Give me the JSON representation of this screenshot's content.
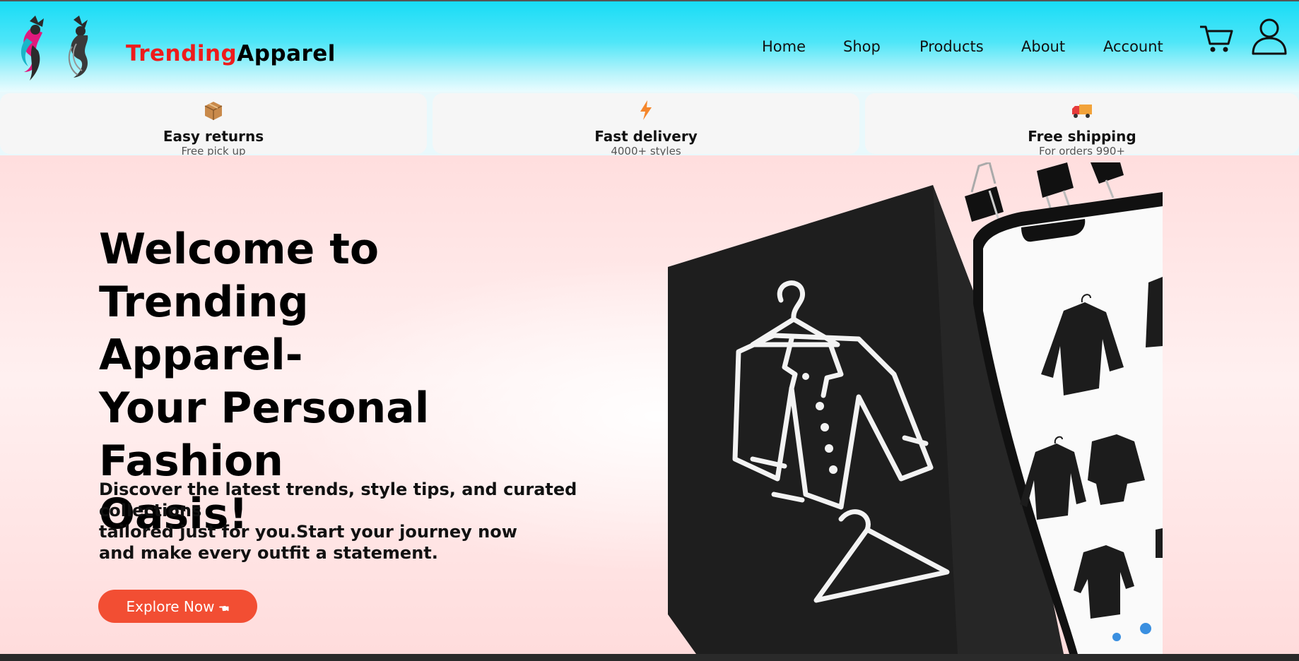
{
  "brand": {
    "part1": "Trending",
    "part2": "Apparel"
  },
  "nav": {
    "items": [
      "Home",
      "Shop",
      "Products",
      "About",
      "Account"
    ]
  },
  "icons": {
    "logo": "fashion-logo-icon",
    "cart": "cart-icon",
    "user": "user-icon"
  },
  "features": [
    {
      "icon": "package-icon",
      "title": "Easy returns",
      "subtitle": "Free pick up"
    },
    {
      "icon": "lightning-icon",
      "title": "Fast delivery",
      "subtitle": "4000+ styles"
    },
    {
      "icon": "delivery-truck-icon",
      "title": "Free shipping",
      "subtitle": "For orders 990+"
    }
  ],
  "hero": {
    "title_lines": [
      "Welcome to Trending",
      "Apparel-",
      "Your Personal Fashion",
      "Oasis!"
    ],
    "description_lines": [
      "Discover the latest trends, style tips, and curated",
      "collections",
      "tailored just for you.Start your journey now",
      "and make every outfit a statement."
    ],
    "cta_label": "Explore Now 🖜"
  },
  "colors": {
    "brand_red": "#ee1b1b",
    "header_cyan": "#18dcf6",
    "cta": "#f24e33",
    "hero_pink": "#ffdede"
  }
}
